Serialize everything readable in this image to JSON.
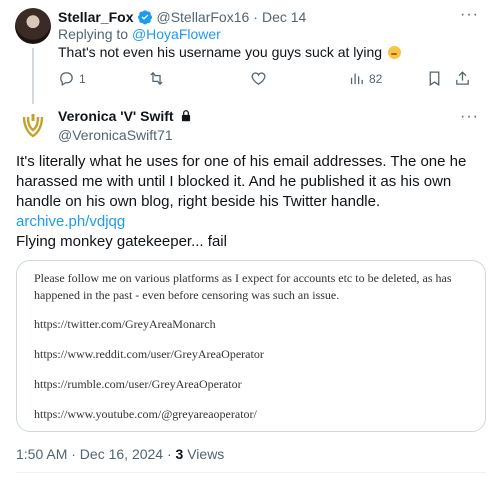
{
  "reply": {
    "name": "Stellar_Fox",
    "handle": "@StellarFox16",
    "separator": "·",
    "date": "Dec 14",
    "replying_prefix": "Replying to ",
    "replying_to": "@HoyaFlower",
    "text": "That's not even his username you guys suck at lying",
    "more": "···",
    "actions": {
      "reply_count": "1",
      "views_count": "82"
    }
  },
  "tweet": {
    "name": "Veronica 'V' Swift",
    "handle": "@VeronicaSwift71",
    "more": "···",
    "lines": [
      "It's literally what he uses for one of his email addresses.  The one he",
      "harassed me with until I blocked it.   And he published it as his own",
      "handle on his own blog, right beside his Twitter handle."
    ],
    "link": "archive.ph/vdjqg",
    "closing": "Flying monkey gatekeeper... fail",
    "card": {
      "intro_1": "Please follow me on various platforms as I expect for accounts etc to be deleted, as has",
      "intro_2": "happened in the past - even before censoring was such an issue.",
      "links": [
        "https://twitter.com/GreyAreaMonarch",
        "https://www.reddit.com/user/GreyAreaOperator",
        "https://rumble.com/user/GreyAreaOperator",
        "https://www.youtube.com/@greyareaoperator/"
      ]
    },
    "meta": {
      "time": "1:50 AM · Dec 16, 2024 · ",
      "views_count": "3",
      "views_label": " Views"
    }
  },
  "colors": {
    "accent": "#1d9bf0",
    "muted": "#536471",
    "text": "#0f1419",
    "border": "#cfd9de"
  }
}
